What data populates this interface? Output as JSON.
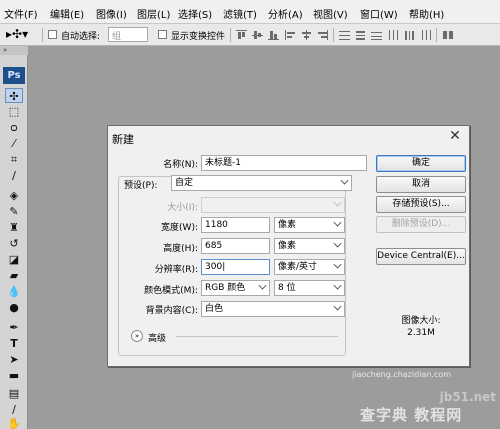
{
  "menu": [
    "文件(F)",
    "编辑(E)",
    "图像(I)",
    "图层(L)",
    "选择(S)",
    "滤镜(T)",
    "分析(A)",
    "视图(V)",
    "窗口(W)",
    "帮助(H)"
  ],
  "options_bar": {
    "auto_select_label": "自动选择:",
    "auto_select_value": "组",
    "show_transform_label": "显示变换控件"
  },
  "toolbox": {
    "collapse": "»",
    "logo": "Ps",
    "tools": [
      "move-tool",
      "marquee-tool",
      "lasso-tool",
      "magic-wand-tool",
      "crop-tool",
      "eyedropper-tool",
      "healing-brush-tool",
      "brush-tool",
      "clone-stamp-tool",
      "history-brush-tool",
      "eraser-tool",
      "gradient-tool",
      "blur-tool",
      "dodge-tool",
      "pen-tool",
      "type-tool",
      "path-selection-tool",
      "shape-tool",
      "notes-tool",
      "eyedropper2-tool",
      "hand-tool"
    ]
  },
  "dialog": {
    "title": "新建",
    "name_label": "名称(N):",
    "name_value": "未标题-1",
    "preset_label": "预设(P):",
    "preset_value": "自定",
    "size_label": "大小(I):",
    "width_label": "宽度(W):",
    "width_value": "1180",
    "width_unit": "像素",
    "height_label": "高度(H):",
    "height_value": "685",
    "height_unit": "像素",
    "resolution_label": "分辨率(R):",
    "resolution_value": "300",
    "resolution_unit": "像素/英寸",
    "color_mode_label": "颜色模式(M):",
    "color_mode_value": "RGB 颜色",
    "bit_depth_value": "8 位",
    "background_label": "背景内容(C):",
    "background_value": "白色",
    "advanced_label": "高级",
    "ok_button": "确定",
    "cancel_button": "取消",
    "save_preset_button": "存储预设(S)...",
    "delete_preset_button": "删除预设(D)...",
    "device_central_button": "Device Central(E)...",
    "image_size_label": "图像大小:",
    "image_size_value": "2.31M"
  },
  "watermark": {
    "site": "jb51.net",
    "brand": "查字典 教程网",
    "url": "jiaocheng.chazidian.com"
  }
}
